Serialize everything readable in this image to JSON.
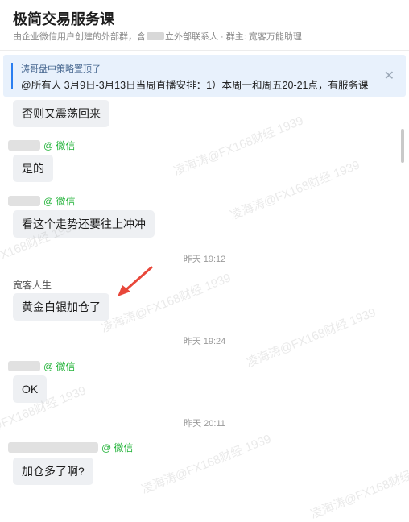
{
  "header": {
    "title": "极简交易服务课",
    "subtitle_a": "由企业微信用户创建的外部群，含",
    "subtitle_b": "立外部联系人 · 群主: 宽客万能助理"
  },
  "pinned": {
    "title": "涛哥盘中策略置顶了",
    "text": "@所有人 3月9日-3月13日当周直播安排：1）本周一和周五20-21点，有服务课...",
    "close_icon": "close-icon"
  },
  "messages": {
    "m1": "否则又震荡回来",
    "s2_tag": "@ 微信",
    "m2": "是的",
    "s3_tag": "@ 微信",
    "m3": "看这个走势还要往上冲冲",
    "t1": "昨天 19:12",
    "s4_name": "宽客人生",
    "m4": "黄金白银加仓了",
    "t2": "昨天 19:24",
    "s5_tag": "@ 微信",
    "m5": "OK",
    "t3": "昨天 20:11",
    "s6_tag": "@ 微信",
    "m6": "加仓多了啊?"
  },
  "watermark": "凌海涛@FX168财经 1939",
  "colors": {
    "pinned_bg": "#e8f1fc",
    "accent": "#2a7ef0",
    "wechat_green": "#23b33a",
    "bubble_bg": "#eef0f3",
    "arrow": "#e8473a"
  }
}
